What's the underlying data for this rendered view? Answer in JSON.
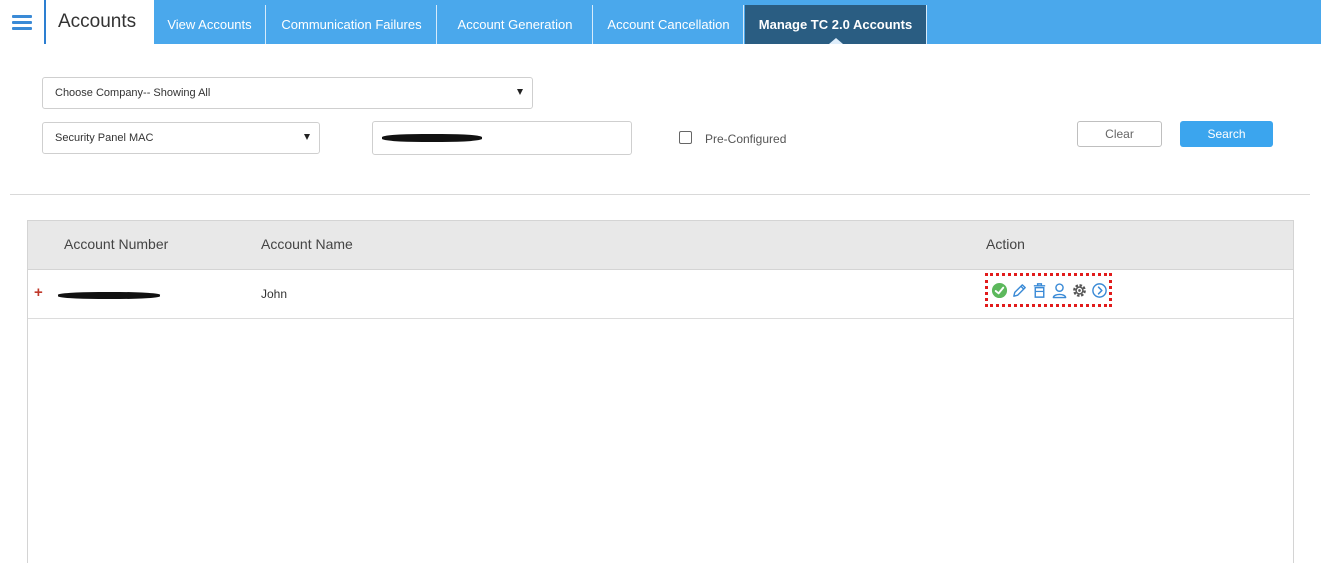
{
  "header": {
    "title": "Accounts",
    "tabs": [
      {
        "label": "View Accounts",
        "active": false
      },
      {
        "label": "Communication Failures",
        "active": false
      },
      {
        "label": "Account Generation",
        "active": false
      },
      {
        "label": "Account Cancellation",
        "active": false
      },
      {
        "label": "Manage TC 2.0 Accounts",
        "active": true
      }
    ]
  },
  "filters": {
    "company_select": "Choose Company-- Showing All",
    "field_select": "Security Panel MAC",
    "preconfigured_label": "Pre-Configured",
    "preconfigured_checked": false,
    "clear_label": "Clear",
    "search_label": "Search"
  },
  "table": {
    "columns": [
      "Account Number",
      "Account Name",
      "Action"
    ],
    "rows": [
      {
        "account_number": "",
        "account_name": "John",
        "actions": [
          "check-circle-icon",
          "edit-pencil-icon",
          "delete-trash-icon",
          "user-icon",
          "settings-gear-icon",
          "navigate-arrow-icon"
        ]
      }
    ]
  },
  "colors": {
    "nav_bar": "#4aa8ec",
    "active_tab": "#2a5d82",
    "search_button": "#3ba5ee",
    "highlight_border": "#e11b1b",
    "action_icon": "#3a8ad6",
    "check_icon": "#5cb85c"
  }
}
